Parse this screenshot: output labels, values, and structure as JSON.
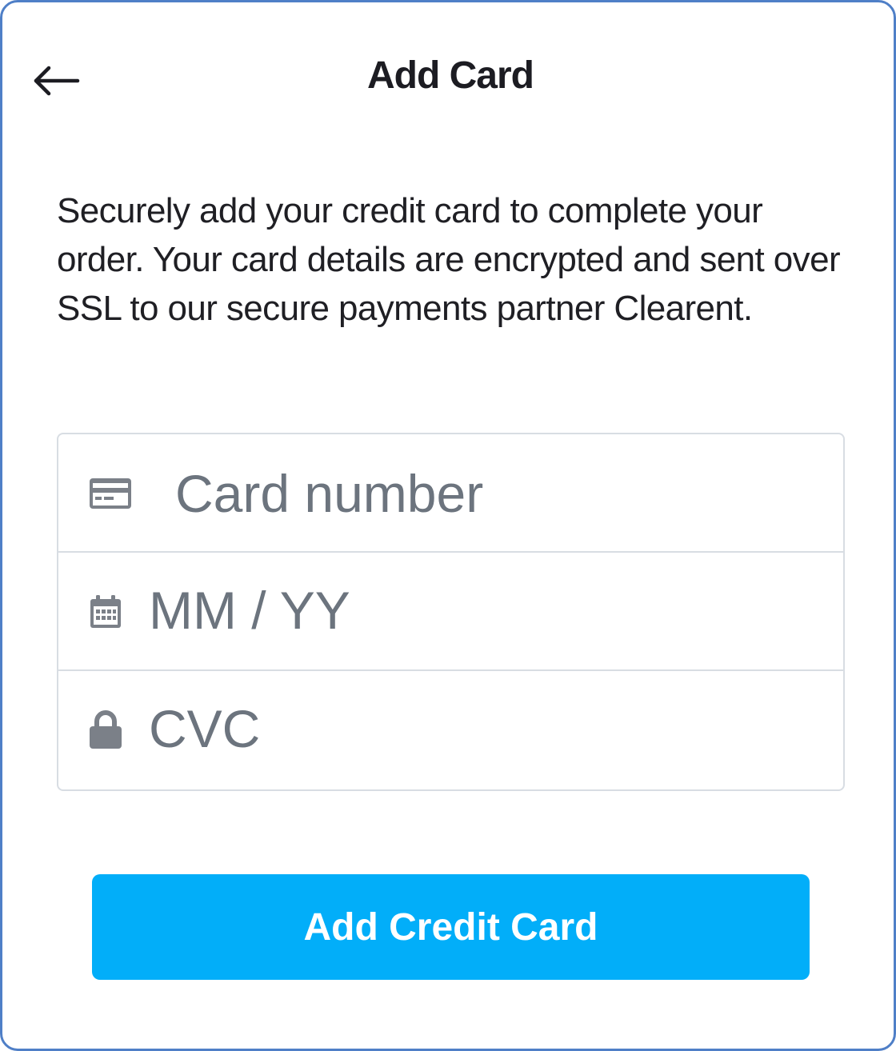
{
  "header": {
    "title": "Add Card",
    "back_icon": "arrow-left-icon"
  },
  "description": "Securely add your credit card to complete your order. Your card details are encrypted and sent over SSL to our secure payments partner Clearent.",
  "form": {
    "card_number": {
      "icon": "credit-card-icon",
      "placeholder": "Card number",
      "value": ""
    },
    "expiry": {
      "icon": "calendar-icon",
      "placeholder": "MM / YY",
      "value": ""
    },
    "cvc": {
      "icon": "lock-icon",
      "placeholder": "CVC",
      "value": ""
    }
  },
  "actions": {
    "submit_label": "Add Credit Card"
  },
  "colors": {
    "accent": "#02aef9",
    "placeholder": "#6c747e",
    "border": "#d8dde3",
    "text": "#1f1f24"
  }
}
